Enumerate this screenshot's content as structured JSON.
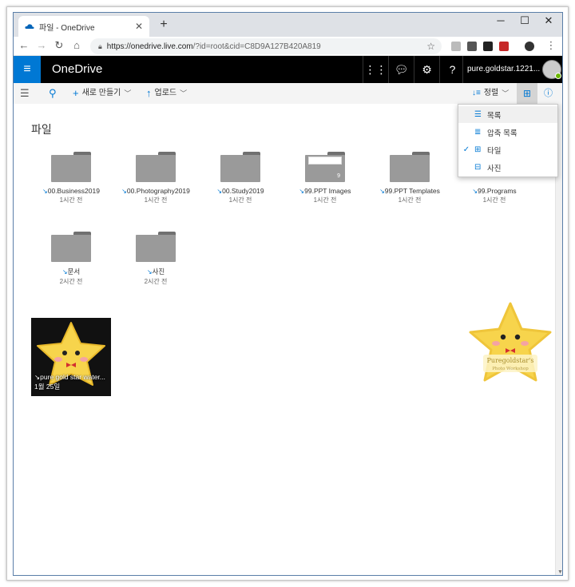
{
  "browser": {
    "tab_title": "파일 - OneDrive",
    "tab_close": "✕",
    "new_tab": "+",
    "url_host": "https://onedrive.live.com",
    "url_path": "/?id=root&cid=C8D9A127B420A819",
    "win_minimize": "─",
    "win_maximize": "☐",
    "win_close": "✕"
  },
  "header": {
    "brand": "OneDrive",
    "account_name": "pure.goldstar.1221..."
  },
  "commandbar": {
    "new_label": "새로 만들기",
    "upload_label": "업로드",
    "sort_label": "정렬"
  },
  "page": {
    "title": "파일"
  },
  "folders": [
    {
      "name": "00.Business2019",
      "meta": "1시간 전"
    },
    {
      "name": "00.Photography2019",
      "meta": "1시간 전"
    },
    {
      "name": "00.Study2019",
      "meta": "1시간 전"
    },
    {
      "name": "99.PPT Images",
      "meta": "1시간 전",
      "count": "9"
    },
    {
      "name": "99.PPT Templates",
      "meta": "1시간 전"
    },
    {
      "name": "99.Programs",
      "meta": "1시간 전"
    },
    {
      "name": "문서",
      "meta": "2시간 전"
    },
    {
      "name": "사진",
      "meta": "2시간 전"
    }
  ],
  "photo": {
    "name": "pure gold star water...",
    "meta": "1월 25일"
  },
  "view_menu": {
    "items": [
      {
        "label": "목록",
        "checked": false
      },
      {
        "label": "압축 목록",
        "checked": false
      },
      {
        "label": "타일",
        "checked": true
      },
      {
        "label": "사진",
        "checked": false
      }
    ]
  },
  "sticker": {
    "text_line1": "Puregoldstar's",
    "text_line2": "Photo Workshop"
  },
  "colors": {
    "accent": "#0078d4",
    "header_bg": "#000000",
    "folder": "#9a9a9a",
    "star": "#f7d44c"
  }
}
